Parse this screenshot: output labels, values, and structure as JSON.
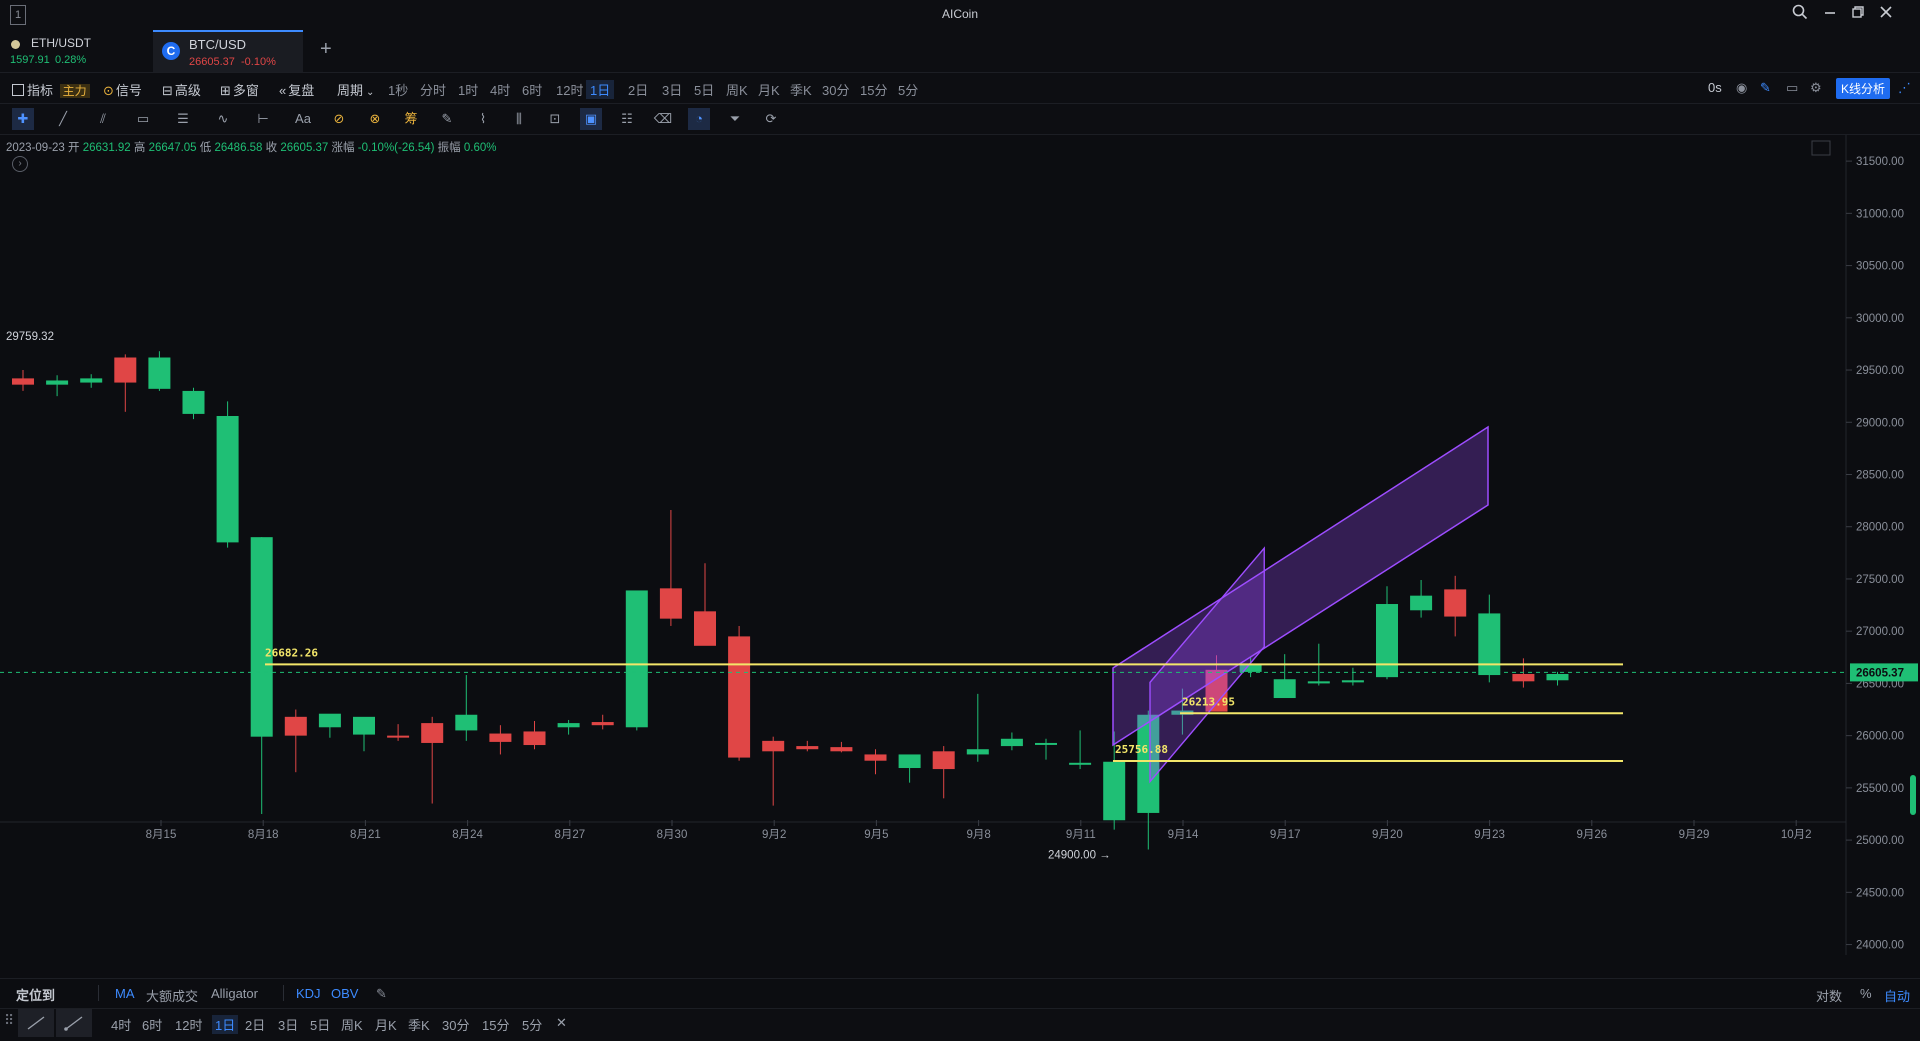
{
  "window": {
    "title": "AICoin",
    "badge": "1"
  },
  "tabs": [
    {
      "symbol": "ETH/USDT",
      "price": "1597.91",
      "change": "0.28%"
    },
    {
      "symbol": "BTC/USD",
      "price": "26605.37",
      "change": "-0.10%"
    }
  ],
  "new_tab": "+",
  "toolbar": {
    "indicator": "指标",
    "main": "主力",
    "signal": "信号",
    "advanced": "高级",
    "multiwindow": "多窗",
    "replay": "复盘",
    "period": "周期",
    "periods": [
      "1秒",
      "分时",
      "1时",
      "4时",
      "6时",
      "12时",
      "1日",
      "2日",
      "3日",
      "5日",
      "周K",
      "月K",
      "季K",
      "30分",
      "15分",
      "5分"
    ],
    "active_period": "1日",
    "countdown": "0s",
    "kline_analysis": "K线分析"
  },
  "ohlc": {
    "date": "2023-09-23",
    "open_label": "开",
    "open": "26631.92",
    "high_label": "高",
    "high": "26647.05",
    "low_label": "低",
    "low": "26486.58",
    "close_label": "收",
    "close": "26605.37",
    "change_label": "涨幅",
    "change": "-0.10%(-26.54)",
    "amp_label": "振幅",
    "amp": "0.60%"
  },
  "colors": {
    "up": "#1fbf75",
    "down": "#e04646",
    "accent": "#3d8bff",
    "level": "#f3e66a",
    "channel": "#9d4dff"
  },
  "chart_data": {
    "type": "candlestick",
    "y_range": [
      23900,
      31750
    ],
    "y_ticks": [
      "31500.00",
      "31000.00",
      "30500.00",
      "30000.00",
      "29500.00",
      "29000.00",
      "28500.00",
      "28000.00",
      "27500.00",
      "27000.00",
      "26500.00",
      "26000.00",
      "25500.00",
      "25000.00",
      "24500.00",
      "24000.00"
    ],
    "x_labels": [
      "8月15",
      "8月18",
      "8月21",
      "8月24",
      "8月27",
      "8月30",
      "9月2",
      "9月5",
      "9月8",
      "9月11",
      "9月14",
      "9月17",
      "9月20",
      "9月23",
      "9月26",
      "9月29",
      "10月2"
    ],
    "candles": [
      [
        29420,
        29500,
        29300,
        29360
      ],
      [
        29360,
        29450,
        29250,
        29400
      ],
      [
        29380,
        29460,
        29330,
        29420
      ],
      [
        29620,
        29650,
        29100,
        29380
      ],
      [
        29320,
        29680,
        29300,
        29620
      ],
      [
        29080,
        29330,
        29030,
        29300
      ],
      [
        27850,
        29200,
        27800,
        29060
      ],
      [
        25990,
        27900,
        25250,
        27900
      ],
      [
        26180,
        26250,
        25650,
        26000
      ],
      [
        26080,
        26120,
        25980,
        26210
      ],
      [
        26010,
        26120,
        25850,
        26180
      ],
      [
        26000,
        26110,
        25950,
        25990
      ],
      [
        26120,
        26180,
        25350,
        25930
      ],
      [
        26050,
        26580,
        25950,
        26200
      ],
      [
        26020,
        26100,
        25820,
        25940
      ],
      [
        26040,
        26140,
        25870,
        25910
      ],
      [
        26080,
        26150,
        26010,
        26120
      ],
      [
        26130,
        26200,
        26060,
        26100
      ],
      [
        26080,
        26230,
        26050,
        27390
      ],
      [
        27410,
        28160,
        27050,
        27120
      ],
      [
        27190,
        27650,
        26950,
        26860
      ],
      [
        26950,
        27050,
        25760,
        25790
      ],
      [
        25950,
        25990,
        25330,
        25850
      ],
      [
        25900,
        25950,
        25850,
        25870
      ],
      [
        25890,
        25940,
        25840,
        25850
      ],
      [
        25820,
        25870,
        25630,
        25760
      ],
      [
        25690,
        25710,
        25550,
        25820
      ],
      [
        25850,
        25900,
        25400,
        25680
      ],
      [
        25820,
        26400,
        25750,
        25870
      ],
      [
        25900,
        26030,
        25860,
        25970
      ],
      [
        25920,
        25970,
        25770,
        25930
      ],
      [
        25740,
        26050,
        25680,
        25740
      ],
      [
        25190,
        26040,
        25100,
        25750
      ],
      [
        25260,
        26240,
        24910,
        26200
      ],
      [
        26200,
        26450,
        26010,
        26240
      ],
      [
        26630,
        26770,
        26580,
        26230
      ],
      [
        26610,
        26750,
        26560,
        26680
      ],
      [
        26360,
        26780,
        26390,
        26540
      ],
      [
        26500,
        26880,
        26480,
        26520
      ],
      [
        26510,
        26650,
        26480,
        26530
      ],
      [
        26560,
        27430,
        26540,
        27260
      ],
      [
        27200,
        27490,
        27130,
        27340
      ],
      [
        27400,
        27530,
        26950,
        27140
      ],
      [
        26580,
        27350,
        26510,
        27170
      ],
      [
        26590,
        26740,
        26460,
        26520
      ],
      [
        26530,
        26610,
        26480,
        26590
      ]
    ],
    "levels": [
      {
        "price": 26682.26,
        "label": "26682.26"
      },
      {
        "price": 26213.95,
        "label": "26213.95"
      },
      {
        "price": 25756.88,
        "label": "25756.88"
      }
    ],
    "current_price": "26605.37",
    "high_marker": "29759.32",
    "low_marker": "24900.00 →"
  },
  "bottom": {
    "locate": "定位到",
    "indicators": [
      "MA",
      "大额成交",
      "Alligator"
    ],
    "sub_indicators": [
      "KDJ",
      "OBV"
    ],
    "log": "对数",
    "percent": "%",
    "auto": "自动",
    "periods": [
      "4时",
      "6时",
      "12时",
      "1日",
      "2日",
      "3日",
      "5日",
      "周K",
      "月K",
      "季K",
      "30分",
      "15分",
      "5分"
    ],
    "active_period": "1日"
  }
}
